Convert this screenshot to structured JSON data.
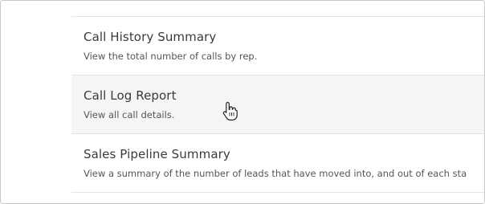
{
  "reports": {
    "items": [
      {
        "title": "Call History Summary",
        "description": "View the total number of calls by rep.",
        "hovered": false
      },
      {
        "title": "Call Log Report",
        "description": "View all call details.",
        "hovered": true
      },
      {
        "title": "Sales Pipeline Summary",
        "description": "View a summary of the number of leads that have moved into, and out of each sta",
        "hovered": false
      }
    ]
  },
  "icons": {
    "cursor": "hand-pointer-icon"
  },
  "colors": {
    "hover_background": "#f5f5f5",
    "divider": "#e3e3e3",
    "title_text": "#3a3a3a",
    "description_text": "#555555"
  }
}
